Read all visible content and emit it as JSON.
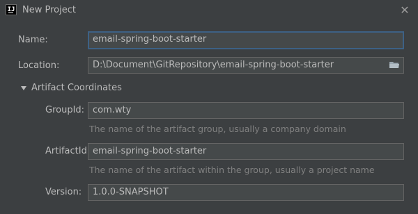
{
  "window": {
    "title": "New Project",
    "app_icon_text": "IJ"
  },
  "form": {
    "name_label": "Name:",
    "name_value": "email-spring-boot-starter",
    "location_label": "Location:",
    "location_value": "D:\\Document\\GitRepository\\email-spring-boot-starter",
    "section_label": "Artifact Coordinates",
    "groupid_label": "GroupId:",
    "groupid_value": "com.wty",
    "groupid_hint": "The name of the artifact group, usually a company domain",
    "artifactid_label": "ArtifactId:",
    "artifactid_value": "email-spring-boot-starter",
    "artifactid_hint": "The name of the artifact within the group, usually a project name",
    "version_label": "Version:",
    "version_value": "1.0.0-SNAPSHOT"
  },
  "icons": {
    "app": "intellij-icon",
    "close": "close-icon",
    "folder": "folder-icon",
    "expand": "triangle-down-icon"
  },
  "colors": {
    "background": "#3c3f41",
    "field_background": "#45494a",
    "focus_border": "#3d6185",
    "text": "#bbbbbb",
    "hint_text": "#808080"
  }
}
